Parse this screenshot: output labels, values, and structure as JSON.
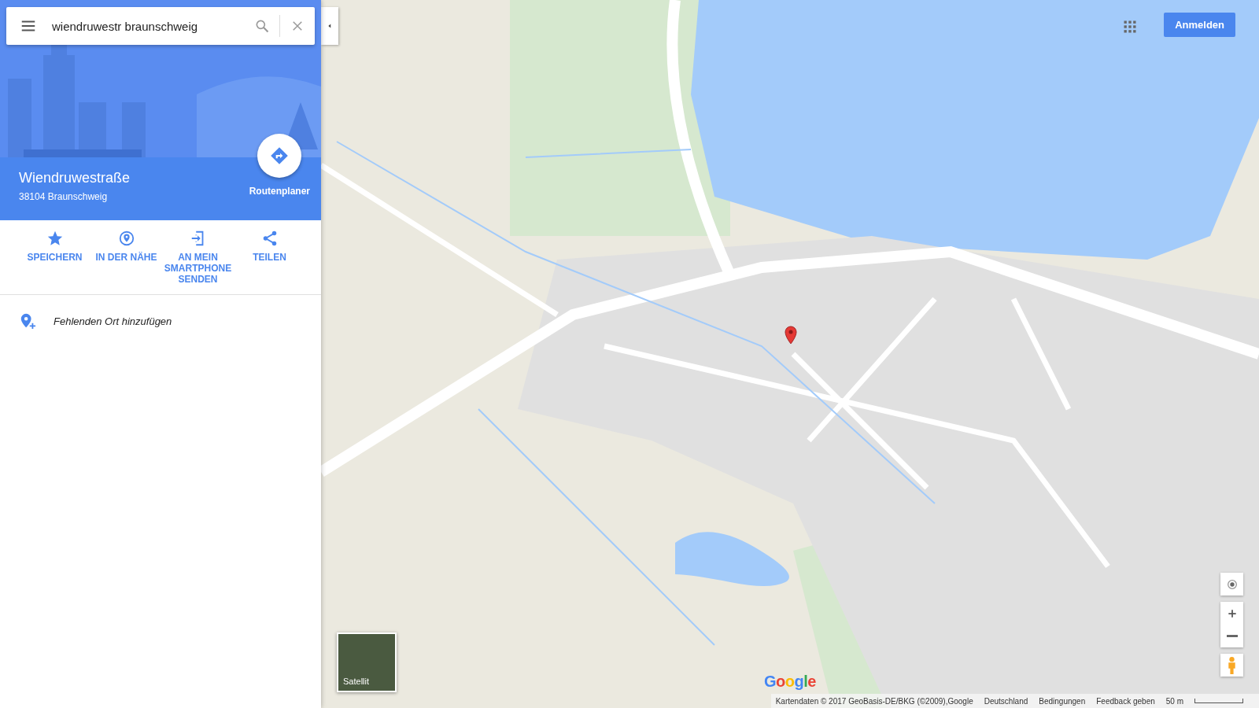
{
  "search": {
    "value": "wiendruwestr braunschweig"
  },
  "place": {
    "title": "Wiendruwestraße",
    "address": "38104 Braunschweig",
    "route_label": "Routenplaner"
  },
  "actions": [
    {
      "kind": "star",
      "label": "SPEICHERN"
    },
    {
      "kind": "nearby",
      "label": "IN DER NÄHE"
    },
    {
      "kind": "send",
      "label": "AN MEIN SMARTPHONE SENDEN"
    },
    {
      "kind": "share",
      "label": "TEILEN"
    }
  ],
  "add_place": {
    "label": "Fehlenden Ort hinzufügen"
  },
  "header": {
    "signin": "Anmelden"
  },
  "map": {
    "layer_toggle": "Satellit",
    "logo": "Google",
    "footer": [
      "Kartendaten © 2017 GeoBasis-DE/BKG (©2009),Google",
      "Deutschland",
      "Bedingungen",
      "Feedback geben"
    ],
    "scale": "50 m"
  }
}
